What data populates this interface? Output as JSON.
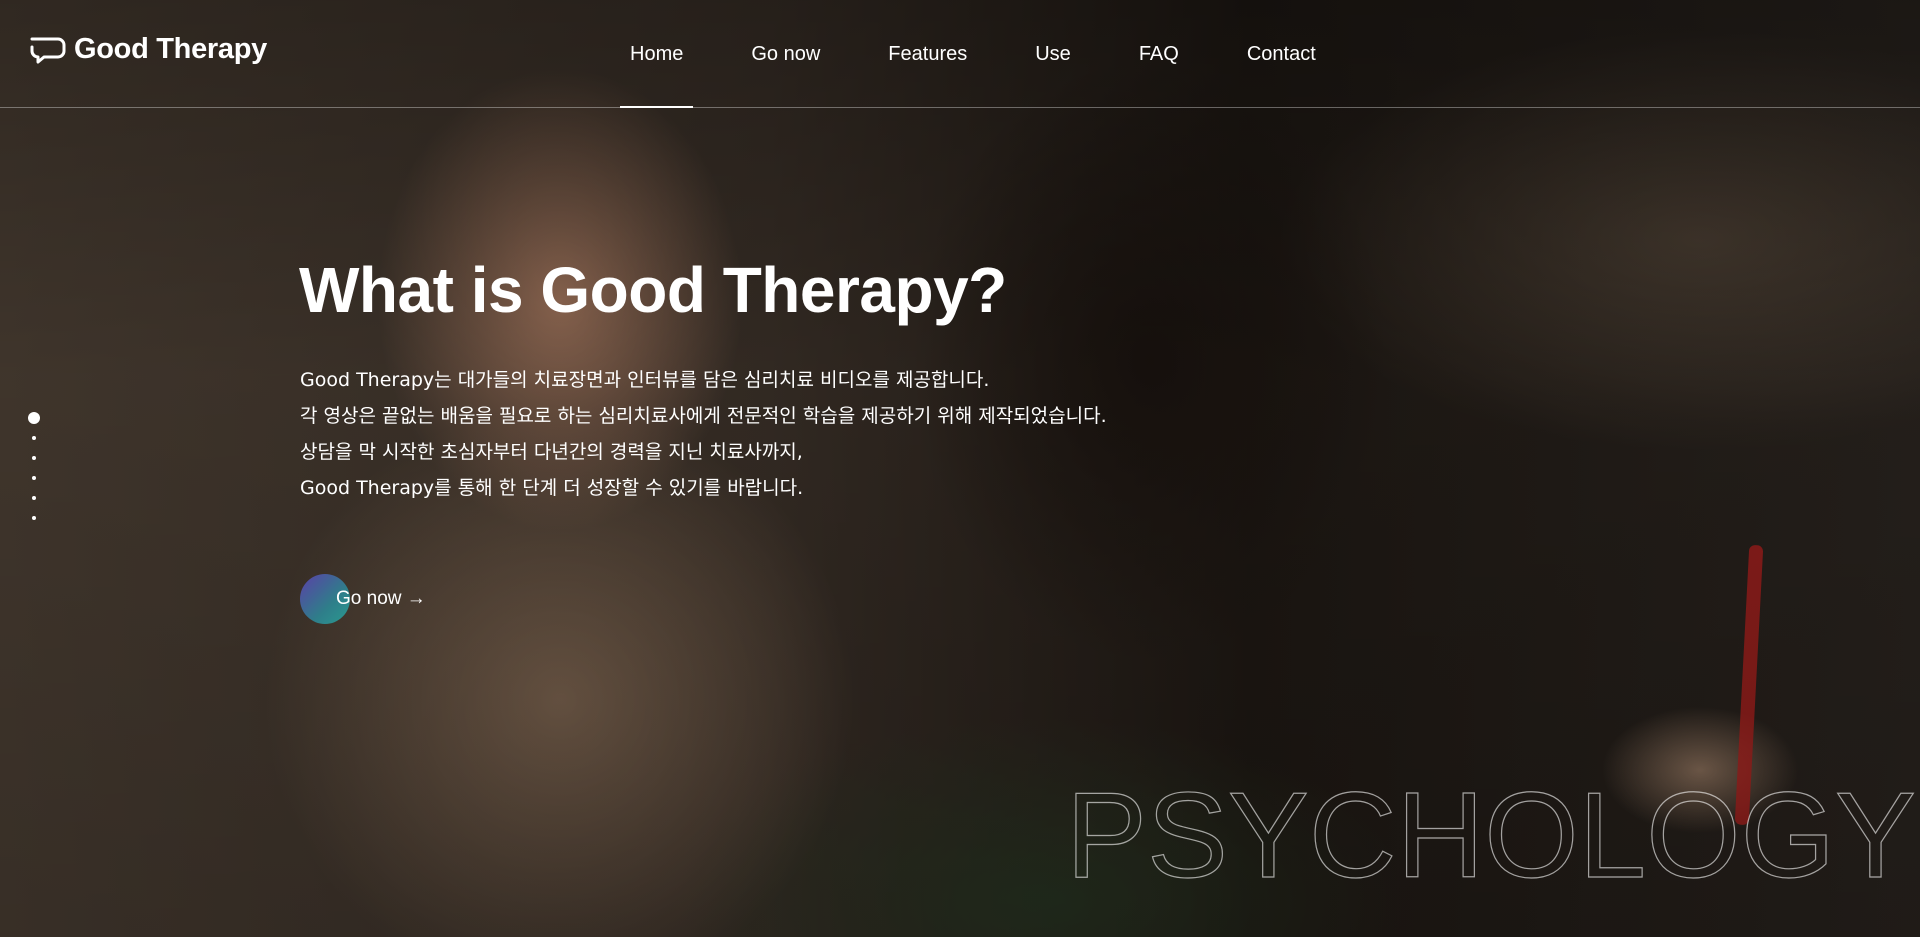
{
  "brand": {
    "name": "Good Therapy",
    "logo_icon": "speech-bubble-icon"
  },
  "nav": {
    "items": [
      {
        "label": "Home",
        "active": true
      },
      {
        "label": "Go now",
        "active": false
      },
      {
        "label": "Features",
        "active": false
      },
      {
        "label": "Use",
        "active": false
      },
      {
        "label": "FAQ",
        "active": false
      },
      {
        "label": "Contact",
        "active": false
      }
    ]
  },
  "hero": {
    "title": "What is Good Therapy?",
    "lines": [
      "Good Therapy는 대가들의 치료장면과 인터뷰를 담은 심리치료 비디오를 제공합니다.",
      "각 영상은 끝없는 배움을 필요로 하는 심리치료사에게 전문적인 학습을 제공하기 위해 제작되었습니다.",
      "상담을 막 시작한 초심자부터 다년간의 경력을 지닌 치료사까지,",
      "Good Therapy를 통해 한 단계 더 성장할 수 있기를 바랍니다."
    ],
    "cta_label": "Go now →"
  },
  "pager": {
    "count": 6,
    "active_index": 0
  },
  "watermark": "PSYCHOLOGY",
  "colors": {
    "accent_start": "#5b3fa8",
    "accent_end": "#2a9a8f"
  }
}
